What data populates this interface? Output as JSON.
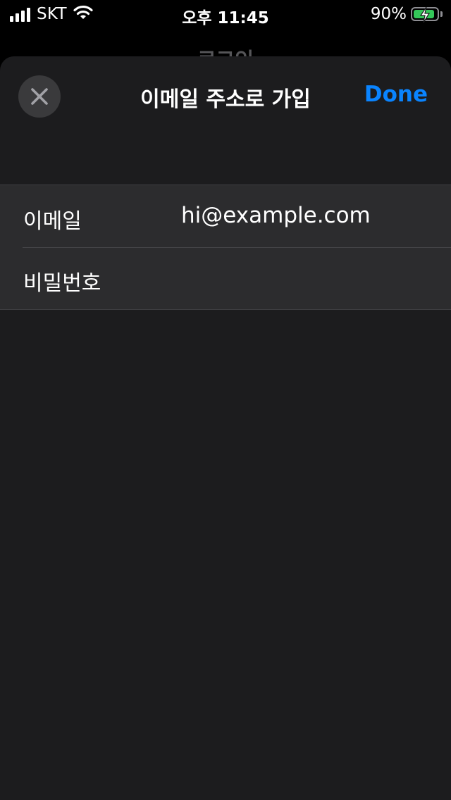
{
  "status_bar": {
    "carrier": "SKT",
    "time": "오후 11:45",
    "battery_percent": "90%",
    "battery_level": 0.9,
    "signal_icon": "cellular-signal-icon",
    "wifi_icon": "wifi-icon",
    "battery_icon": "battery-charging-icon"
  },
  "background": {
    "title": "로그인"
  },
  "sheet": {
    "title": "이메일 주소로 가입",
    "done_label": "Done",
    "close_icon": "close-icon",
    "accent_color": "#0a84ff"
  },
  "form": {
    "email": {
      "label": "이메일",
      "value": "hi@example.com"
    },
    "password": {
      "label": "비밀번호",
      "value": ""
    }
  }
}
